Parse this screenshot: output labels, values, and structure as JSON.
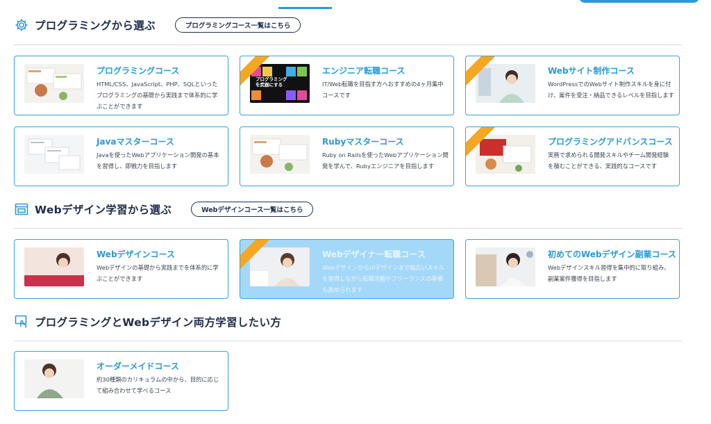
{
  "sections": [
    {
      "title": "プログラミングから選ぶ",
      "button": "プログラミングコース一覧はこちら",
      "icon": "gear-icon"
    },
    {
      "title": "Webデザイン学習から選ぶ",
      "button": "Webデザインコース一覧はこちら",
      "icon": "web-window-icon"
    },
    {
      "title": "プログラミングとWebデザイン両方学習したい方",
      "icon": "monitor-touch-icon"
    }
  ],
  "courses": [
    {
      "title": "プログラミングコース",
      "desc": "HTML/CSS、JavaScript、PHP、SQLといったプログラミングの基礎から実践まで体系的に学ぶことができます",
      "ribbon": false
    },
    {
      "title": "エンジニア転職コース",
      "desc": "IT/Web転職を目指す方へおすすめの4ヶ月集中コースです",
      "ribbon": true,
      "thumb_text": "プログラミングを武器にする"
    },
    {
      "title": "Webサイト制作コース",
      "desc": "WordPressでのWebサイト制作スキルを身に付け、案件を受注・納品できるレベルを目指します",
      "ribbon": true
    },
    {
      "title": "Javaマスターコース",
      "desc": "Javaを使ったWebアプリケーション開発の基本を習得し、即戦力を目指します",
      "ribbon": false
    },
    {
      "title": "Rubyマスターコース",
      "desc": "Ruby on Railsを使ったWebアプリケーション開発を学んで、Rubyエンジニアを目指します",
      "ribbon": false
    },
    {
      "title": "プログラミングアドバンスコース",
      "desc": "実務で求められる開発スキルやチーム開発経験を積むことができる、実践的なコースです",
      "ribbon": true
    },
    {
      "title": "Webデザインコース",
      "desc": "Webデザインの基礎から実践までを体系的に学ぶことができます",
      "ribbon": false
    },
    {
      "title": "Webデザイナー転職コース",
      "desc": "WebデザインからUIデザインまで幅広いスキルを習得しながら転職活動やフリーランスの準備も進められます",
      "ribbon": true
    },
    {
      "title": "初めてのWebデザイン副業コース",
      "desc": "Webデザインスキル習得を集中的に取り組み、副業案件獲得を目指します",
      "ribbon": false
    },
    {
      "title": "オーダーメイドコース",
      "desc": "約30種類のカリキュラムの中から、目的に応じて組み合わせて学べるコース",
      "ribbon": false
    }
  ],
  "colors": {
    "accent": "#2a9ad6",
    "navy": "#1f2d4a",
    "ribbon": "#f5a623",
    "hover_card": "#a4d8f8"
  }
}
